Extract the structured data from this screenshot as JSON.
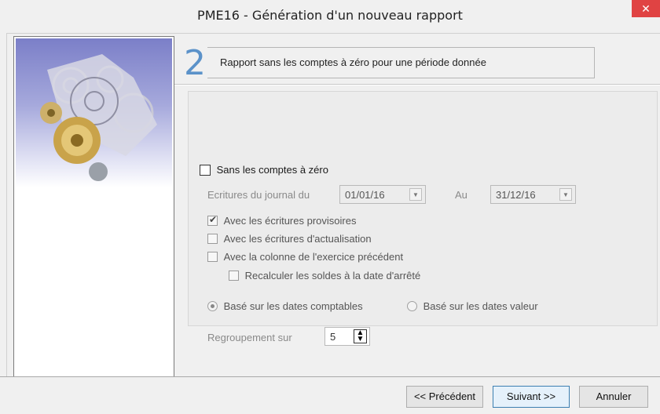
{
  "window": {
    "title": "PME16 - Génération d'un nouveau rapport",
    "close_glyph": "✕"
  },
  "step": {
    "number": "2",
    "description": "Rapport sans les comptes à zéro pour une  période donnée"
  },
  "options": {
    "sans_zero_label": "Sans les comptes à zéro",
    "sans_zero_checked": false,
    "ecritures_label": "Ecritures du journal du",
    "date_from": "01/01/16",
    "au_label": "Au",
    "date_to": "31/12/16",
    "provisoires_label": "Avec les écritures provisoires",
    "provisoires_checked": true,
    "actualisation_label": "Avec les écritures d'actualisation",
    "exercice_label": "Avec la colonne de l'exercice précédent",
    "recalculer_label": "Recalculer les soldes à la date d'arrêté",
    "radio_comptables_label": "Basé sur les dates comptables",
    "radio_valeur_label": "Basé sur les dates valeur",
    "selected_radio": "comptables",
    "regroupement_label": "Regroupement sur",
    "regroupement_value": "5"
  },
  "buttons": {
    "previous": "<< Précédent",
    "next": "Suivant >>",
    "cancel": "Annuler"
  },
  "icons": {
    "close": "close-icon",
    "dropdown": "chevron-down-icon",
    "spinner": "up-down-arrows-icon",
    "illustration": "gears-icon"
  },
  "colors": {
    "close_bg": "#e04343",
    "step_number": "#5b92c9",
    "focus_border": "#3c7fb1"
  }
}
